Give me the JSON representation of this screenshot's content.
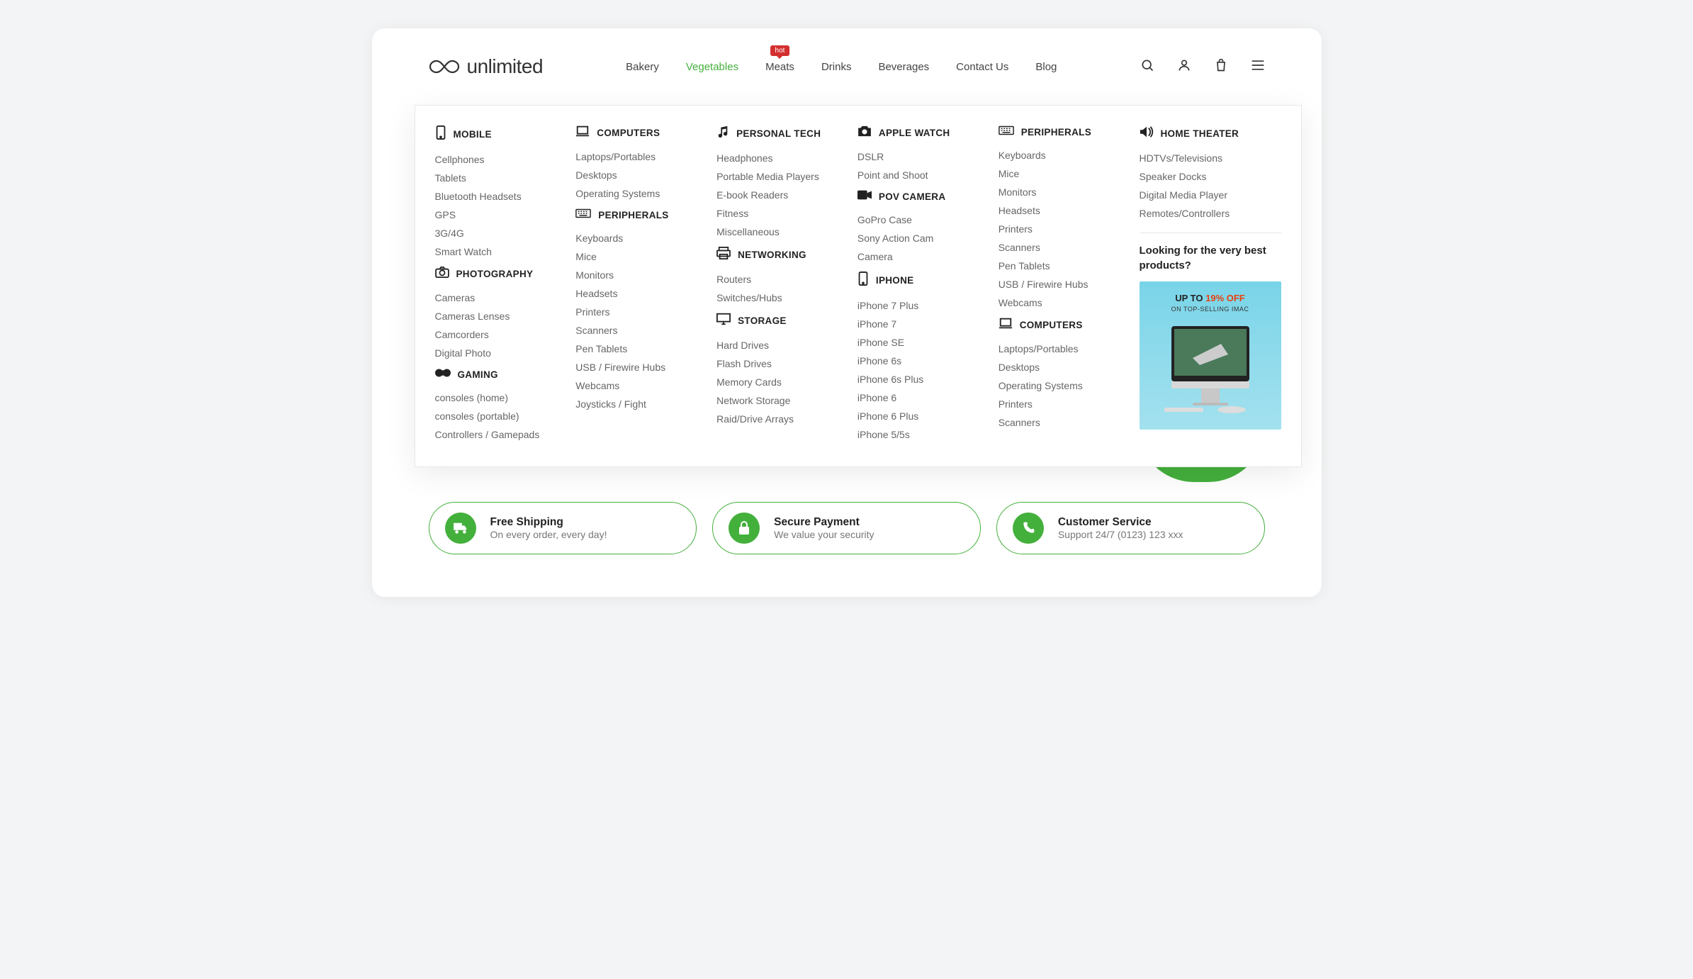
{
  "logo": {
    "text": "unlimited"
  },
  "nav": {
    "items": [
      {
        "label": "Bakery"
      },
      {
        "label": "Vegetables",
        "active": true
      },
      {
        "label": "Meats",
        "badge": "hot"
      },
      {
        "label": "Drinks"
      },
      {
        "label": "Beverages"
      },
      {
        "label": "Contact Us"
      },
      {
        "label": "Blog"
      }
    ]
  },
  "mega": {
    "col0": {
      "sec0": {
        "title": "MOBILE",
        "icon": "phone-icon",
        "links": [
          "Cellphones",
          "Tablets",
          "Bluetooth Headsets",
          "GPS",
          "3G/4G",
          "Smart Watch"
        ]
      },
      "sec1": {
        "title": "PHOTOGRAPHY",
        "icon": "camera-icon",
        "links": [
          "Cameras",
          "Cameras Lenses",
          "Camcorders",
          "Digital Photo"
        ]
      },
      "sec2": {
        "title": "GAMING",
        "icon": "gamepad-icon",
        "links": [
          "consoles (home)",
          "consoles (portable)",
          "Controllers / Gamepads"
        ]
      }
    },
    "col1": {
      "sec0": {
        "title": "COMPUTERS",
        "icon": "laptop-icon",
        "links": [
          "Laptops/Portables",
          "Desktops",
          "Operating Systems"
        ]
      },
      "sec1": {
        "title": "PERIPHERALS",
        "icon": "keyboard-icon",
        "links": [
          "Keyboards",
          "Mice",
          "Monitors",
          "Headsets",
          "Printers",
          "Scanners",
          "Pen Tablets",
          "USB / Firewire Hubs",
          "Webcams",
          "Joysticks / Fight"
        ]
      }
    },
    "col2": {
      "sec0": {
        "title": "PERSONAL TECH",
        "icon": "music-icon",
        "links": [
          "Headphones",
          "Portable Media Players",
          "E-book Readers",
          "Fitness",
          "Miscellaneous"
        ]
      },
      "sec1": {
        "title": "NETWORKING",
        "icon": "printer-icon",
        "links": [
          "Routers",
          "Switches/Hubs"
        ]
      },
      "sec2": {
        "title": "STORAGE",
        "icon": "monitor-icon",
        "links": [
          "Hard Drives",
          "Flash Drives",
          "Memory Cards",
          "Network Storage",
          "Raid/Drive Arrays"
        ]
      }
    },
    "col3": {
      "sec0": {
        "title": "APPLE WATCH",
        "icon": "camera-solid-icon",
        "links": [
          "DSLR",
          "Point and Shoot"
        ]
      },
      "sec1": {
        "title": "POV CAMERA",
        "icon": "video-icon",
        "links": [
          "GoPro Case",
          "Sony Action Cam",
          "Camera"
        ]
      },
      "sec2": {
        "title": "IPHONE",
        "icon": "phone-icon",
        "links": [
          "iPhone 7 Plus",
          "iPhone 7",
          "iPhone SE",
          "iPhone 6s",
          "iPhone 6s Plus",
          "iPhone 6",
          "iPhone 6 Plus",
          "iPhone 5/5s"
        ]
      }
    },
    "col4": {
      "sec0": {
        "title": "PERIPHERALS",
        "icon": "keyboard-icon",
        "links": [
          "Keyboards",
          "Mice",
          "Monitors",
          "Headsets",
          "Printers",
          "Scanners",
          "Pen Tablets",
          "USB / Firewire Hubs",
          "Webcams"
        ]
      },
      "sec1": {
        "title": "COMPUTERS",
        "icon": "laptop-icon",
        "links": [
          "Laptops/Portables",
          "Desktops",
          "Operating Systems",
          "Printers",
          "Scanners"
        ]
      }
    },
    "promo": {
      "title": "HOME THEATER",
      "icon": "speaker-icon",
      "links": [
        "HDTVs/Televisions",
        "Speaker Docks",
        "Digital Media Player",
        "Remotes/Controllers"
      ],
      "heading": "Looking for the very best products?",
      "upto": "UP TO ",
      "pct": "19% OFF",
      "sub": "ON TOP-SELLING IMAC"
    }
  },
  "features": [
    {
      "icon": "truck-icon",
      "title": "Free Shipping",
      "sub": "On every order, every day!"
    },
    {
      "icon": "lock-icon",
      "title": "Secure Payment",
      "sub": "We value your security"
    },
    {
      "icon": "phone-call-icon",
      "title": "Customer Service",
      "sub": "Support 24/7 (0123) 123 xxx"
    }
  ]
}
